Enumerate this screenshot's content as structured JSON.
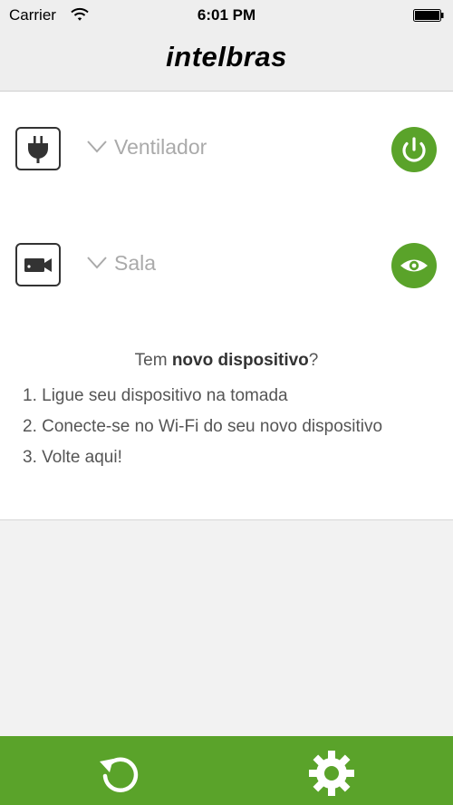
{
  "status_bar": {
    "carrier": "Carrier",
    "time": "6:01 PM"
  },
  "header": {
    "logo_text": "intelbras"
  },
  "devices": [
    {
      "label": "Ventilador",
      "device_icon": "plug-icon",
      "action_icon": "power-icon"
    },
    {
      "label": "Sala",
      "device_icon": "camera-icon",
      "action_icon": "eye-icon"
    }
  ],
  "info": {
    "headline_prefix": "Tem ",
    "headline_bold": "novo dispositivo",
    "headline_suffix": "?",
    "steps": [
      "1. Ligue seu dispositivo na tomada",
      "2. Conecte-se no Wi-Fi do seu novo dispositivo",
      "3. Volte aqui!"
    ]
  },
  "tab_bar": {
    "items": [
      {
        "icon": "refresh-icon"
      },
      {
        "icon": "gear-icon"
      }
    ]
  },
  "colors": {
    "accent": "#5aa32a",
    "label_gray": "#aaaaaa",
    "background": "#f2f2f2"
  }
}
